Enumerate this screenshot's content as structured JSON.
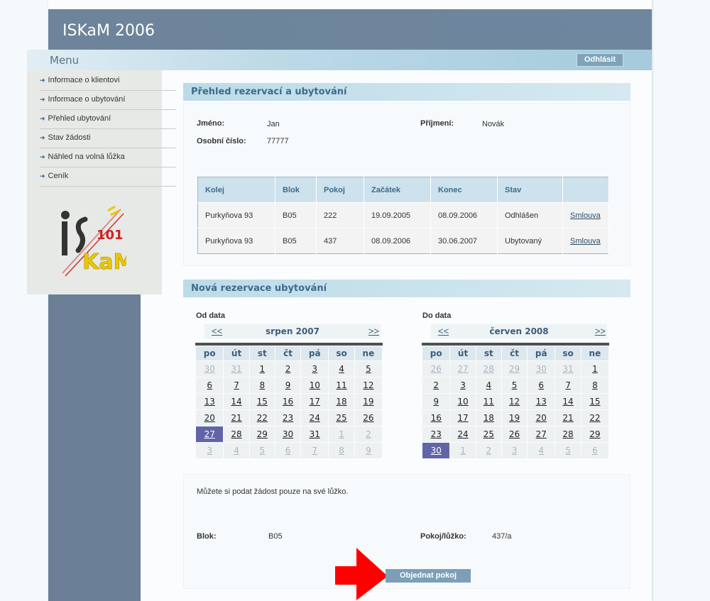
{
  "app": {
    "title": "ISKaM 2006"
  },
  "menu": {
    "title": "Menu",
    "logout_label": "Odhlásit",
    "items": [
      {
        "label": "Informace o klientovi"
      },
      {
        "label": "Informace o ubytování"
      },
      {
        "label": "Přehled ubytování"
      },
      {
        "label": "Stav žádosti"
      },
      {
        "label": "Náhled na volná lůžka"
      },
      {
        "label": "Ceník"
      }
    ]
  },
  "overview": {
    "heading": "Přehled rezervací a ubytování",
    "first_name_label": "Jméno:",
    "first_name": "Jan",
    "last_name_label": "Příjmení:",
    "last_name": "Novák",
    "id_label": "Osobní číslo:",
    "id": "77777",
    "columns": [
      "Kolej",
      "Blok",
      "Pokoj",
      "Začátek",
      "Konec",
      "Stav",
      ""
    ],
    "rows": [
      {
        "kolej": "Purkyňova 93",
        "blok": "B05",
        "pokoj": "222",
        "zacatek": "19.09.2005",
        "konec": "08.09.2006",
        "stav": "Odhlášen",
        "link": "Smlouva"
      },
      {
        "kolej": "Purkyňova 93",
        "blok": "B05",
        "pokoj": "437",
        "zacatek": "08.09.2006",
        "konec": "30.06.2007",
        "stav": "Ubytovaný",
        "link": "Smlouva"
      }
    ]
  },
  "new_reservation": {
    "heading": "Nová rezervace ubytování",
    "weekdays": [
      "po",
      "út",
      "st",
      "čt",
      "pá",
      "so",
      "ne"
    ],
    "from": {
      "label": "Od data",
      "prev": "<<",
      "next": ">>",
      "month": "srpen 2007",
      "selected": "27",
      "weeks": [
        [
          "30",
          "31",
          "1",
          "2",
          "3",
          "4",
          "5"
        ],
        [
          "6",
          "7",
          "8",
          "9",
          "10",
          "11",
          "12"
        ],
        [
          "13",
          "14",
          "15",
          "16",
          "17",
          "18",
          "19"
        ],
        [
          "20",
          "21",
          "22",
          "23",
          "24",
          "25",
          "26"
        ],
        [
          "27",
          "28",
          "29",
          "30",
          "31",
          "1",
          "2"
        ],
        [
          "3",
          "4",
          "5",
          "6",
          "7",
          "8",
          "9"
        ]
      ]
    },
    "to": {
      "label": "Do data",
      "prev": "<<",
      "next": ">>",
      "month": "červen 2008",
      "selected": "30",
      "weeks": [
        [
          "26",
          "27",
          "28",
          "29",
          "30",
          "31",
          "1"
        ],
        [
          "2",
          "3",
          "4",
          "5",
          "6",
          "7",
          "8"
        ],
        [
          "9",
          "10",
          "11",
          "12",
          "13",
          "14",
          "15"
        ],
        [
          "16",
          "17",
          "18",
          "19",
          "20",
          "21",
          "22"
        ],
        [
          "23",
          "24",
          "25",
          "26",
          "27",
          "28",
          "29"
        ],
        [
          "30",
          "1",
          "2",
          "3",
          "4",
          "5",
          "6"
        ]
      ]
    },
    "note": "Můžete si podat žádost pouze na své lůžko.",
    "block_label": "Blok:",
    "block_value": "B05",
    "room_label": "Pokoj/lůžko:",
    "room_value": "437/a",
    "order_label": "Objednat pokoj"
  },
  "colors": {
    "header": "#6d849a",
    "selected_day": "#6264a8",
    "arrow": "#ff0000"
  }
}
